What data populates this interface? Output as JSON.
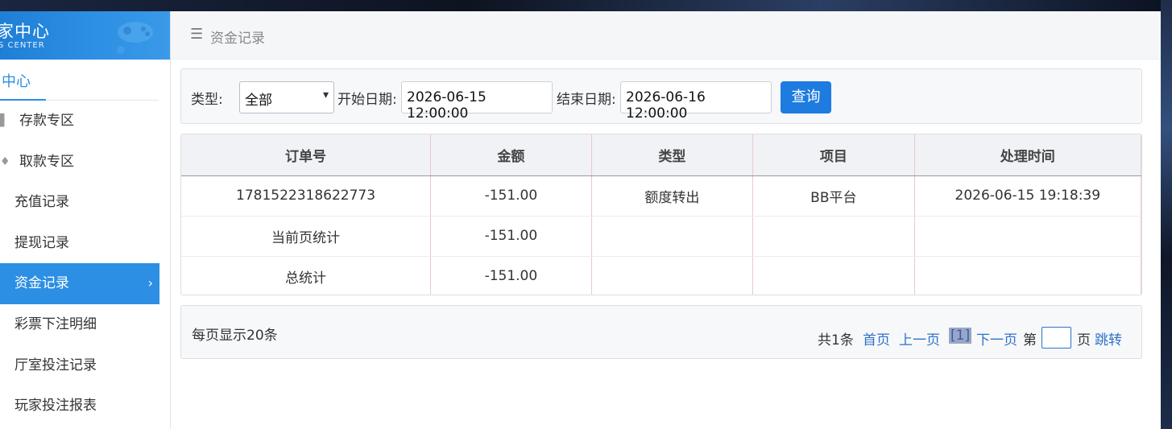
{
  "brand": {
    "title": "家中心",
    "subtitle": "S CENTER"
  },
  "sidebar": {
    "head": "中心",
    "items": [
      {
        "label": "存款专区",
        "mark": "▌"
      },
      {
        "label": "取款专区",
        "mark": "♦"
      },
      {
        "label": "充值记录"
      },
      {
        "label": "提现记录"
      },
      {
        "label": "资金记录",
        "arrow": "›"
      },
      {
        "label": "彩票下注明细"
      },
      {
        "label": "厅室投注记录"
      },
      {
        "label": "玩家投注报表"
      }
    ]
  },
  "topbar": {
    "title": "资金记录"
  },
  "filter": {
    "type_label": "类型:",
    "type_value": "全部",
    "start_label": "开始日期:",
    "start_value": "2026-06-15 12:00:00",
    "end_label": "结束日期:",
    "end_value": "2026-06-16 12:00:00",
    "query_button": "查询"
  },
  "table": {
    "headers": [
      "订单号",
      "金额",
      "类型",
      "项目",
      "处理时间"
    ],
    "rows": [
      [
        "1781522318622773",
        "-151.00",
        "额度转出",
        "BB平台",
        "2026-06-15 19:18:39"
      ],
      [
        "当前页统计",
        "-151.00",
        "",
        "",
        ""
      ],
      [
        "总统计",
        "-151.00",
        "",
        "",
        ""
      ]
    ]
  },
  "pager": {
    "per_page": "每页显示20条",
    "total": "共1条",
    "first": "首页",
    "prev": "上一页",
    "current": "[1]",
    "next": "下一页",
    "goto_prefix": "第",
    "goto_suffix": "页",
    "jump": "跳转"
  },
  "colors": {
    "accent": "#2d8fe3",
    "button": "#1e7be0",
    "link": "#2d72c9"
  },
  "icons": {
    "menu": "hamburger-icon",
    "arrow": "chevron-right-icon",
    "select": "chevron-down-icon"
  }
}
